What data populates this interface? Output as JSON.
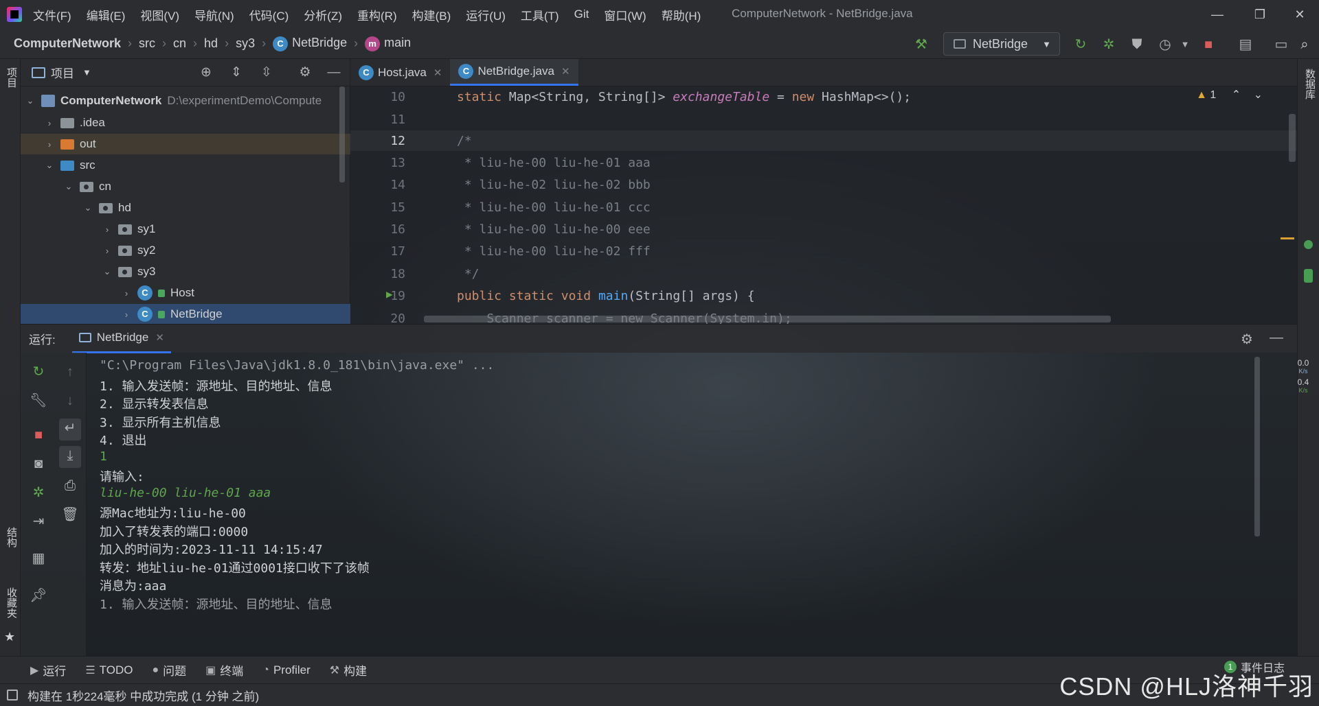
{
  "window": {
    "title": "ComputerNetwork - NetBridge.java"
  },
  "menu": [
    "文件(F)",
    "编辑(E)",
    "视图(V)",
    "导航(N)",
    "代码(C)",
    "分析(Z)",
    "重构(R)",
    "构建(B)",
    "运行(U)",
    "工具(T)",
    "Git",
    "窗口(W)",
    "帮助(H)"
  ],
  "breadcrumb": {
    "project": "ComputerNetwork",
    "items": [
      "src",
      "cn",
      "hd",
      "sy3"
    ],
    "class": "NetBridge",
    "class_icon": "C",
    "method": "main",
    "method_icon": "m"
  },
  "run_config": {
    "name": "NetBridge"
  },
  "left_stripe": {
    "project_label": "项目",
    "structure_label": "结构",
    "favorites_label": "收藏夹"
  },
  "right_stripe": {
    "database_label": "数据库"
  },
  "project_panel": {
    "title": "项目",
    "tree": [
      {
        "label": "ComputerNetwork",
        "path": "D:\\experimentDemo\\Compute",
        "depth": 0,
        "kind": "project",
        "expanded": true
      },
      {
        "label": ".idea",
        "depth": 1,
        "kind": "folder",
        "expanded": false
      },
      {
        "label": "out",
        "depth": 1,
        "kind": "folder-orange",
        "expanded": false
      },
      {
        "label": "src",
        "depth": 1,
        "kind": "folder-blue",
        "expanded": true
      },
      {
        "label": "cn",
        "depth": 2,
        "kind": "package",
        "expanded": true
      },
      {
        "label": "hd",
        "depth": 3,
        "kind": "package",
        "expanded": true
      },
      {
        "label": "sy1",
        "depth": 4,
        "kind": "package",
        "expanded": false
      },
      {
        "label": "sy2",
        "depth": 4,
        "kind": "package",
        "expanded": false
      },
      {
        "label": "sy3",
        "depth": 4,
        "kind": "package",
        "expanded": true
      },
      {
        "label": "Host",
        "depth": 5,
        "kind": "class",
        "expanded": false
      },
      {
        "label": "NetBridge",
        "depth": 5,
        "kind": "class",
        "expanded": false,
        "selected": true
      }
    ],
    "class_icon": "C"
  },
  "editor": {
    "tabs": [
      {
        "label": "Host.java",
        "icon": "C",
        "active": false
      },
      {
        "label": "NetBridge.java",
        "icon": "C",
        "active": true
      }
    ],
    "warnings": "1",
    "lines": [
      {
        "num": "10",
        "text": ""
      },
      {
        "num": "11",
        "text": ""
      },
      {
        "num": "12",
        "text": "/*"
      },
      {
        "num": "13",
        "text": " * liu-he-00 liu-he-01 aaa"
      },
      {
        "num": "14",
        "text": " * liu-he-02 liu-he-02 bbb"
      },
      {
        "num": "15",
        "text": " * liu-he-00 liu-he-01 ccc"
      },
      {
        "num": "16",
        "text": " * liu-he-00 liu-he-00 eee"
      },
      {
        "num": "17",
        "text": " * liu-he-00 liu-he-02 fff"
      },
      {
        "num": "18",
        "text": " */"
      },
      {
        "num": "19",
        "text": ""
      },
      {
        "num": "20",
        "text": "    Scanner scanner = new Scanner(System.in);"
      }
    ],
    "line10": {
      "kw_static": "static",
      "type": "Map<String, String[]>",
      "field": "exchangeTable",
      "assign": " = ",
      "kw_new": "new",
      "rest": " HashMap<>();"
    },
    "line19": {
      "kw1": "public",
      "kw2": "static",
      "kw3": "void",
      "method": "main",
      "rest": "(String[] args) {"
    }
  },
  "run_panel": {
    "label": "运行:",
    "tab": "NetBridge",
    "console": [
      {
        "text": "\"C:\\Program Files\\Java\\jdk1.8.0_181\\bin\\java.exe\" ...",
        "style": "dim"
      },
      {
        "text": "1. 输入发送帧：源地址、目的地址、信息",
        "style": "normal"
      },
      {
        "text": "2. 显示转发表信息",
        "style": "normal"
      },
      {
        "text": "3. 显示所有主机信息",
        "style": "normal"
      },
      {
        "text": "4. 退出",
        "style": "normal"
      },
      {
        "text": "1",
        "style": "green"
      },
      {
        "text": "请输入:",
        "style": "normal"
      },
      {
        "text": "liu-he-00 liu-he-01 aaa",
        "style": "greenit"
      },
      {
        "text": "源Mac地址为:liu-he-00",
        "style": "normal"
      },
      {
        "text": "加入了转发表的端口:0000",
        "style": "normal"
      },
      {
        "text": "加入的时间为:2023-11-11 14:15:47",
        "style": "normal"
      },
      {
        "text": "转发：地址liu-he-01通过0001接口收下了该帧",
        "style": "normal"
      },
      {
        "text": "消息为:aaa",
        "style": "normal"
      },
      {
        "text": "1. 输入发送帧：源地址、目的地址、信息",
        "style": "normal"
      }
    ],
    "net_up": "0.0",
    "net_down": "0.4",
    "net_unit": "K/s"
  },
  "bottom_tabs": [
    {
      "label": "运行",
      "icon": "▶"
    },
    {
      "label": "TODO",
      "icon": "☰"
    },
    {
      "label": "问题",
      "icon": "●"
    },
    {
      "label": "终端",
      "icon": "▣"
    },
    {
      "label": "Profiler",
      "icon": "◔"
    },
    {
      "label": "构建",
      "icon": "⚒"
    }
  ],
  "event_log": {
    "count": "1",
    "label": "事件日志"
  },
  "status": {
    "message": "构建在 1秒224毫秒 中成功完成 (1 分钟 之前)"
  },
  "watermark": "CSDN @HLJ洛神千羽",
  "colors": {
    "accent": "#3574f0",
    "run_green": "#499c54",
    "stop_red": "#db5c5c",
    "keyword": "#cf8e6d",
    "field": "#c77dbb",
    "method": "#56a8f5",
    "comment": "#7a7e85"
  }
}
